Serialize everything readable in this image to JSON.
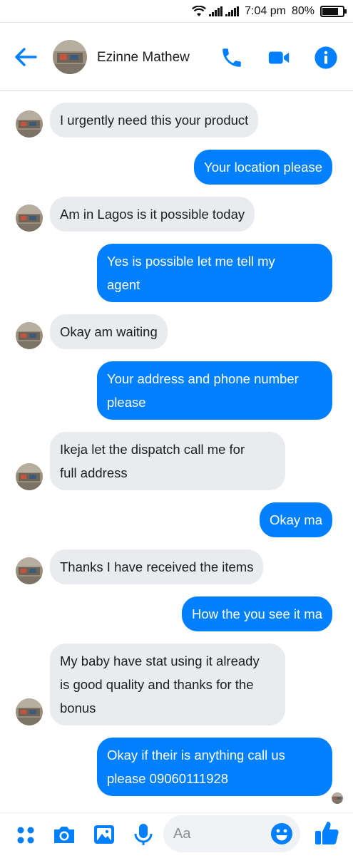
{
  "status_bar": {
    "time": "7:04 pm",
    "battery": "80%",
    "battery_level": 0.8,
    "icons": [
      "wifi-icon",
      "signal-icon",
      "signal-icon",
      "battery-icon"
    ]
  },
  "header": {
    "contact_name": "Ezinne Mathew",
    "icons": [
      "back-arrow-icon",
      "phone-icon",
      "video-camera-icon",
      "info-icon"
    ]
  },
  "messages": [
    {
      "from": "contact",
      "text": "I urgently need this your product"
    },
    {
      "from": "me",
      "text": "Your location please"
    },
    {
      "from": "contact",
      "text": "Am in Lagos is it possible today"
    },
    {
      "from": "me",
      "text": "Yes is possible let me tell my\nagent"
    },
    {
      "from": "contact",
      "text": "Okay am waiting"
    },
    {
      "from": "me",
      "text": "Your address and phone number\nplease"
    },
    {
      "from": "contact",
      "text": "Ikeja let the dispatch call me for\nfull address"
    },
    {
      "from": "me",
      "text": "Okay ma"
    },
    {
      "from": "contact",
      "text": "Thanks I have received the items"
    },
    {
      "from": "me",
      "text": "How the you see it ma"
    },
    {
      "from": "contact",
      "text": "My baby have stat using it already\nis good quality and thanks for the\nbonus"
    },
    {
      "from": "me",
      "text": "Okay if their is anything call us\nplease 09060111928"
    }
  ],
  "composer": {
    "placeholder": "Aa",
    "icons": [
      "apps-grid-icon",
      "camera-icon",
      "image-icon",
      "microphone-icon",
      "emoji-icon",
      "thumbs-up-icon"
    ]
  },
  "colors": {
    "accent": "#0080ff",
    "incoming_bubble": "#e9ebee",
    "outgoing_text": "#ffffff"
  }
}
